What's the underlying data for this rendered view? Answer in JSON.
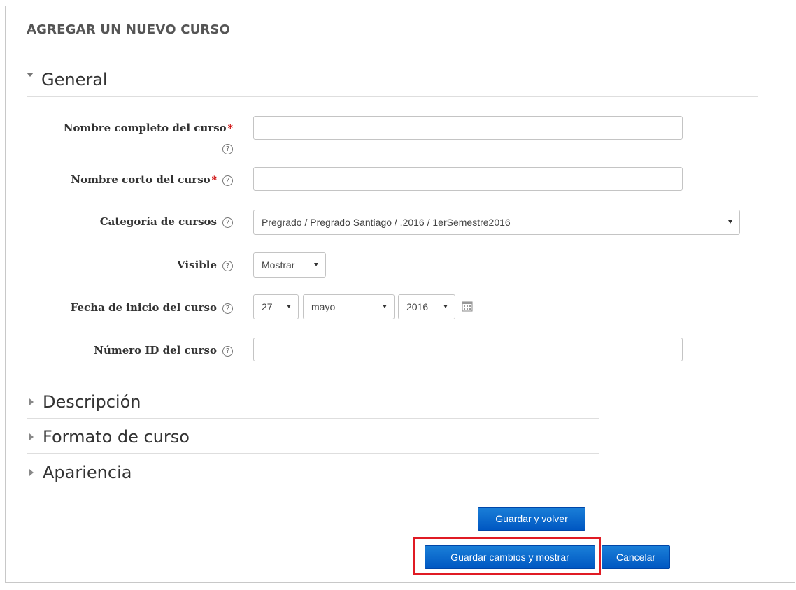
{
  "page": {
    "title": "AGREGAR UN NUEVO CURSO"
  },
  "sections": {
    "general": "General",
    "descripcion": "Descripción",
    "formato": "Formato de curso",
    "apariencia": "Apariencia"
  },
  "form": {
    "fullname_label": "Nombre completo del curso",
    "shortname_label": "Nombre corto del curso",
    "required_mark": "*",
    "help_glyph": "?",
    "category_label": "Categoría de cursos",
    "category_value": "Pregrado / Pregrado Santiago / .2016 / 1erSemestre2016",
    "visible_label": "Visible",
    "visible_value": "Mostrar",
    "startdate_label": "Fecha de inicio del curso",
    "day_value": "27",
    "month_value": "mayo",
    "year_value": "2016",
    "idnumber_label": "Número ID del curso",
    "fullname_value": "",
    "shortname_value": "",
    "idnumber_value": ""
  },
  "buttons": {
    "save_return": "Guardar y volver",
    "save_display": "Guardar cambios y mostrar",
    "cancel": "Cancelar"
  },
  "icons": {
    "help": "help-circle-icon",
    "calendar": "calendar-icon",
    "expanded": "triangle-down-icon",
    "collapsed": "triangle-right-icon"
  },
  "colors": {
    "button": "#0a6ad0",
    "highlight": "#e01b24",
    "required": "#cc0000"
  }
}
